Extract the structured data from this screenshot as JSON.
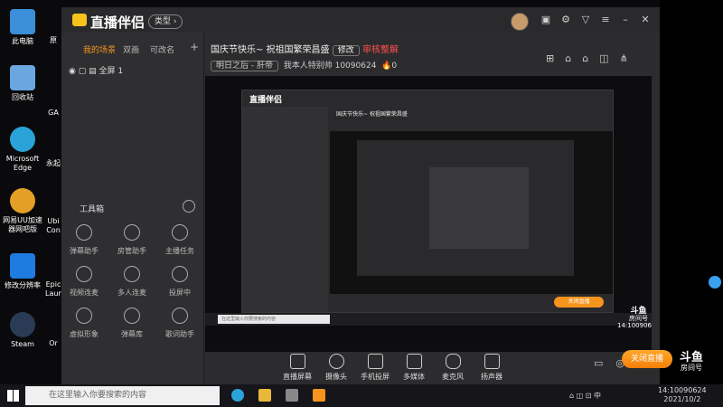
{
  "desktop_left": [
    {
      "label": "此电脑",
      "color": "#3b8fd8"
    },
    {
      "label": "回收站",
      "color": "#6aa7e0"
    },
    {
      "label": "Microsoft Edge",
      "color": "#2aa4d8"
    },
    {
      "label": "网易UU加速器网吧版",
      "color": "#e3a026"
    },
    {
      "label": "修改分辨率",
      "color": "#1e7be0"
    },
    {
      "label": "Steam",
      "color": "#2a3b55"
    }
  ],
  "desktop_col2": [
    "原",
    "GA",
    "永起",
    "Ubi Con",
    "Epic Laun",
    "Or"
  ],
  "app": {
    "name": "直播伴侣",
    "type_label": "类型",
    "scene_tabs": [
      "我的场景",
      "双画",
      "可改名"
    ],
    "scene_add": "+",
    "scene_item": "全屏 1",
    "title": "国庆节快乐~ 祝祖国繁荣昌盛",
    "edit_label": "修改",
    "status": "审核整解",
    "category": "明日之后 - 肝帝",
    "host_label": "我本人特别帅",
    "room_id": "10090624",
    "heat": "0",
    "toolbox_title": "工具箱",
    "tools": [
      "弹幕助手",
      "房管助手",
      "主播任务",
      "视频连麦",
      "多人连麦",
      "投屏中",
      "虚拟形象",
      "弹幕库",
      "歌词助手"
    ],
    "bottom_tools": [
      "直播屏幕",
      "摄像头",
      "手机投屏",
      "多媒体",
      "麦克风",
      "扬声器"
    ],
    "live_button": "关闭直播",
    "room_badge": "14:10090624",
    "room_badge_brand": "斗鱼",
    "room_badge_sub": "房间号"
  },
  "taskbar": {
    "search_placeholder": "在这里输入你要搜索的内容",
    "time": "14:10090624",
    "date": "2021/10/2"
  },
  "colors": {
    "accent": "#f7941d",
    "live_red": "#ff4d4f",
    "bg": "#2c2c2e"
  }
}
